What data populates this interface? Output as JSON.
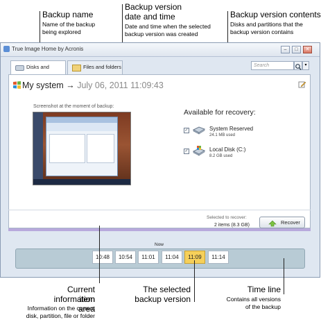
{
  "callouts": {
    "backup_name": {
      "title": "Backup name",
      "desc1": "Name of the backup",
      "desc2": "being explored"
    },
    "backup_version": {
      "title1": "Backup version",
      "title2": "date and time",
      "desc1": "Date and time when the selected",
      "desc2": "backup version was created"
    },
    "version_contents": {
      "title": "Backup version contents",
      "desc1": "Disks and partitions that the",
      "desc2": "backup version contains"
    },
    "current_item": {
      "title1": "Current item",
      "title2": "information area",
      "desc1": "Information on the current",
      "desc2": "disk, partition, file or folder"
    },
    "selected_version": {
      "title1": "The selected",
      "title2": "backup version"
    },
    "time_line": {
      "title": "Time line",
      "desc1": "Contains all versions",
      "desc2": "of the backup"
    }
  },
  "window": {
    "title": "True Image Home by Acronis",
    "tabs": [
      {
        "label": "Disks and partitions"
      },
      {
        "label": "Files and folders"
      }
    ],
    "search": {
      "placeholder": "Search"
    }
  },
  "backup": {
    "name": "My system",
    "arrow": "→",
    "date": "July 06, 2011 11:09:43"
  },
  "screenshot_label": "Screenshot at the moment of backup:",
  "recovery": {
    "title": "Available for recovery:",
    "items": [
      {
        "name": "System Reserved",
        "size": "24.1 MB used",
        "checked": true
      },
      {
        "name": "Local Disk (C:)",
        "size": "8.2 GB used",
        "checked": true
      }
    ]
  },
  "selected": {
    "label": "Selected to recover:",
    "value": "2 items (8.3 GB)"
  },
  "recover_button": "Recover",
  "timeline": {
    "now_label": "Now",
    "versions": [
      "10:48",
      "10:54",
      "11:01",
      "11:04",
      "11:09",
      "11:14"
    ],
    "selected_index": 4
  },
  "colors": {
    "selected_version": "#f6d05a",
    "timeline": "#b8cbd5",
    "accent_bar": "#b8a9dc"
  }
}
